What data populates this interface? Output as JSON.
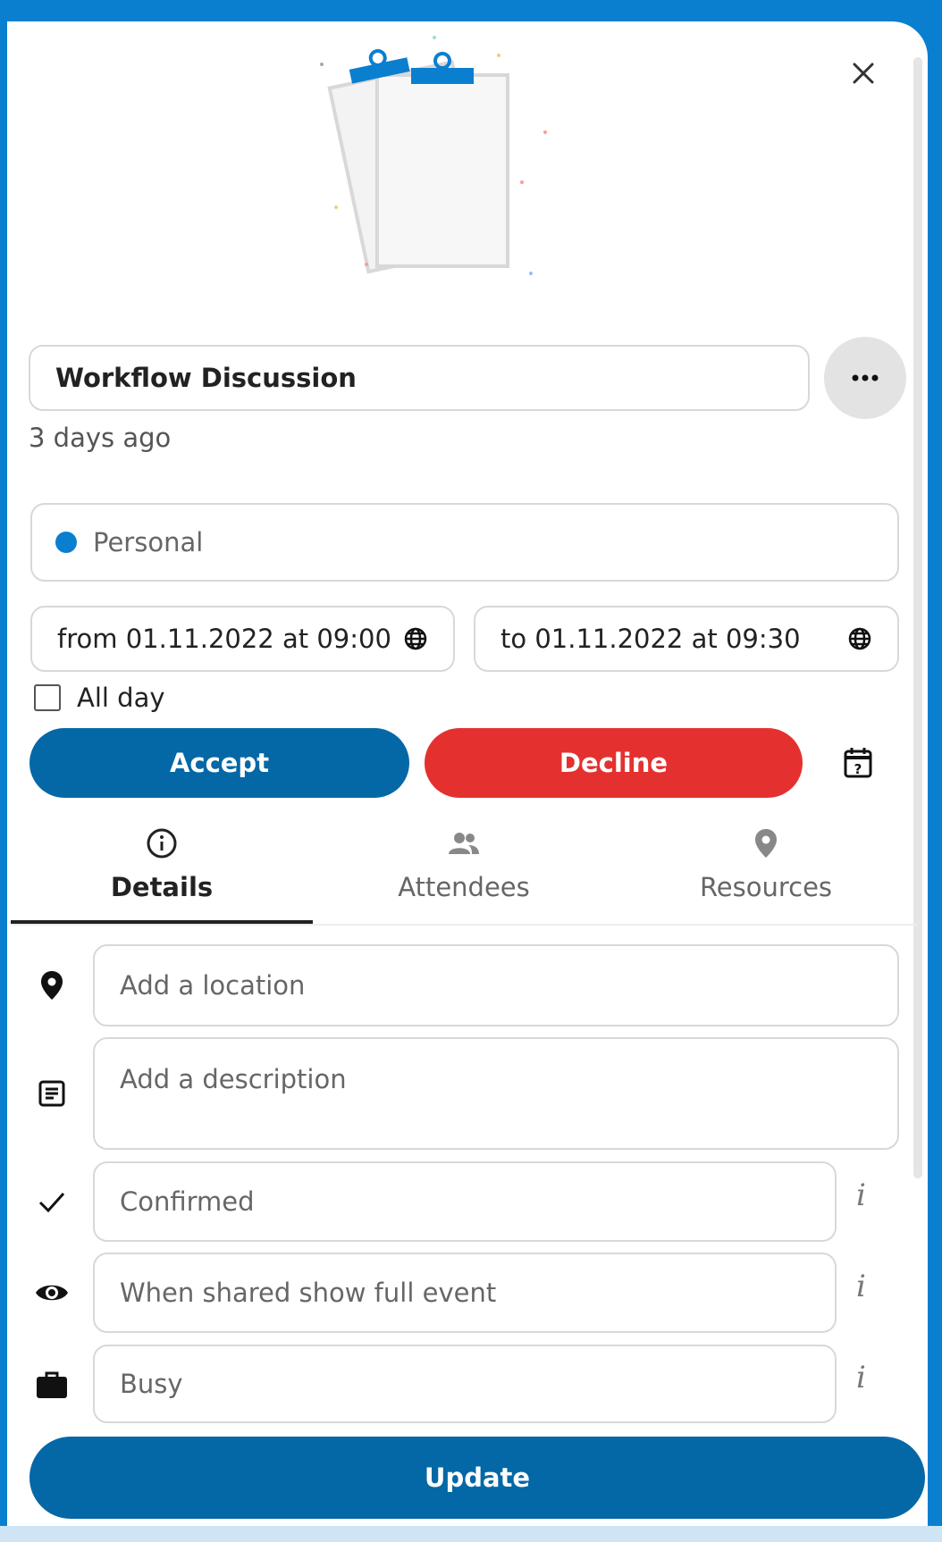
{
  "event": {
    "title": "Workflow Discussion",
    "time_ago": "3 days ago",
    "calendar": "Personal",
    "from": "from 01.11.2022 at 09:00",
    "to": "to 01.11.2022 at 09:30",
    "all_day_label": "All day",
    "all_day_checked": false
  },
  "buttons": {
    "accept": "Accept",
    "decline": "Decline",
    "update": "Update"
  },
  "tabs": [
    {
      "label": "Details",
      "icon": "info-icon",
      "active": true
    },
    {
      "label": "Attendees",
      "icon": "people-icon",
      "active": false
    },
    {
      "label": "Resources",
      "icon": "map-pin-icon",
      "active": false
    }
  ],
  "details": {
    "location_placeholder": "Add a location",
    "description_placeholder": "Add a description",
    "status": "Confirmed",
    "access": "When shared show full event",
    "availability": "Busy",
    "info_glyph": "i"
  },
  "colors": {
    "accent": "#0468a6",
    "decline": "#e4312f",
    "calendar_dot": "#0a7fd0"
  }
}
